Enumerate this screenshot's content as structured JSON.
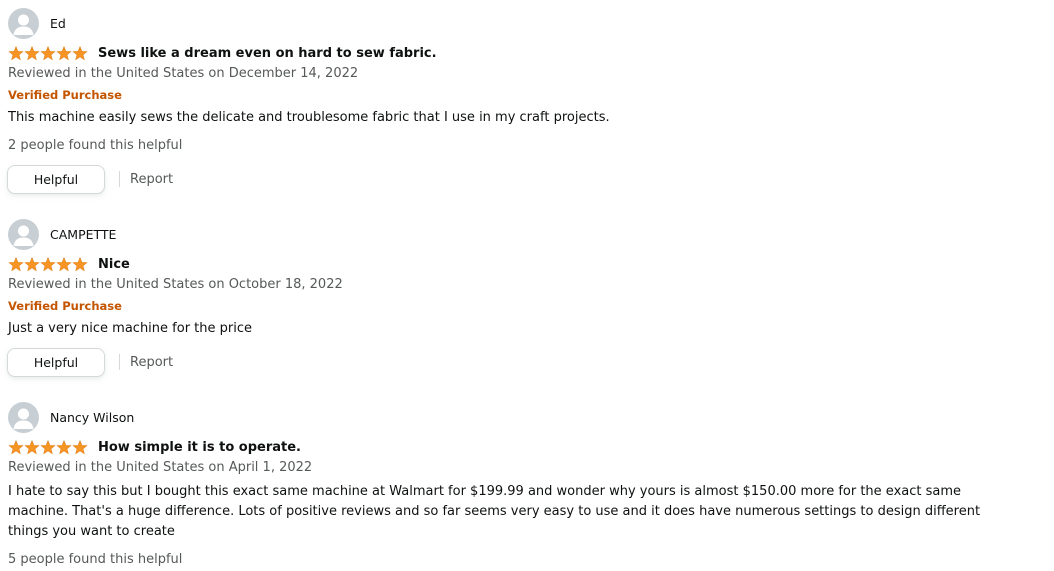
{
  "colors": {
    "star": "#f79426",
    "verified": "#c45500",
    "secondary_text": "#565959",
    "primary_text": "#0f1111"
  },
  "reviews": [
    {
      "profile_name": "Ed",
      "rating": 5,
      "title": "Sews like a dream even on hard to sew fabric.",
      "date": "Reviewed in the United States on December 14, 2022",
      "verified": "Verified Purchase",
      "body": "This machine easily sews the delicate and troublesome fabric that I use in my craft projects.",
      "helpful_count": "2 people found this helpful",
      "helpful_label": "Helpful",
      "report_label": "Report"
    },
    {
      "profile_name": "CAMPETTE",
      "rating": 5,
      "title": "Nice",
      "date": "Reviewed in the United States on October 18, 2022",
      "verified": "Verified Purchase",
      "body": "Just a very nice machine for the price",
      "helpful_label": "Helpful",
      "report_label": "Report"
    },
    {
      "profile_name": "Nancy Wilson",
      "rating": 5,
      "title": "How simple it is to operate.",
      "date": "Reviewed in the United States on April 1, 2022",
      "body": "I hate to say this but I bought this exact same machine at Walmart for $199.99 and wonder why yours is almost $150.00 more for the exact same machine. That's a huge difference. Lots of positive reviews and so far seems very easy to use and it does have numerous settings to design different things you want to create",
      "helpful_count": "5 people found this helpful"
    }
  ]
}
